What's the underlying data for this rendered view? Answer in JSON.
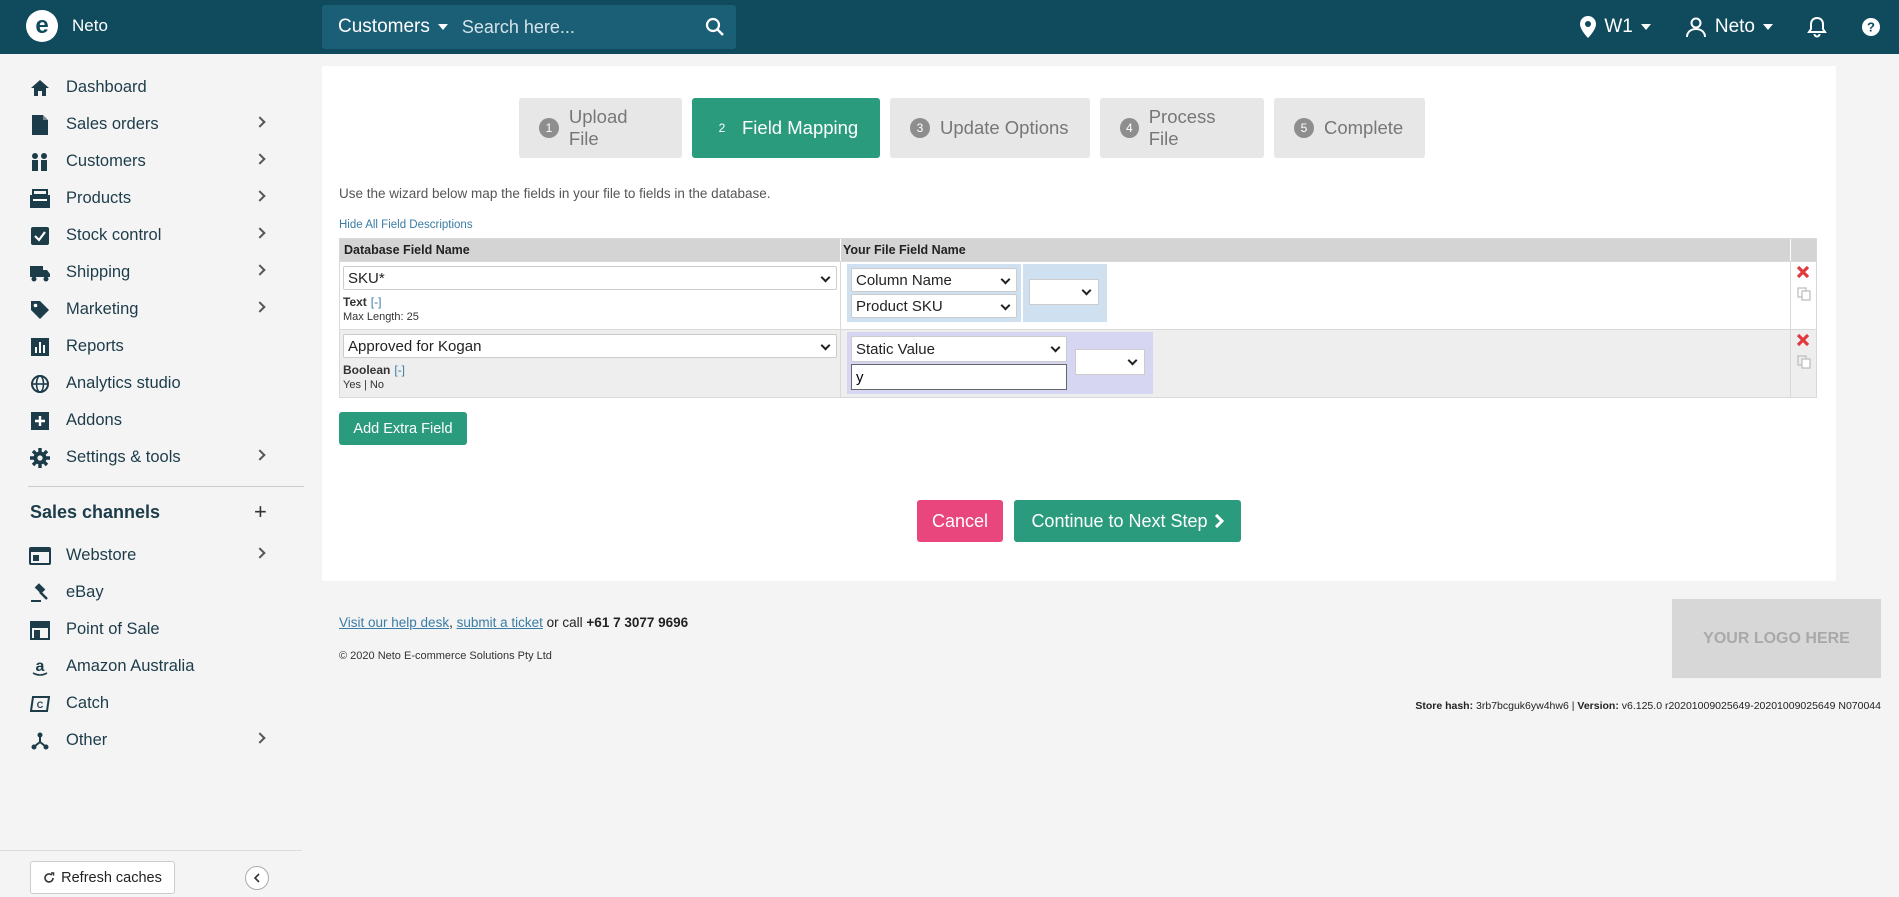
{
  "app": {
    "brand_name": "Neto",
    "brand_letter": "e"
  },
  "search": {
    "scope": "Customers",
    "placeholder": "Search here..."
  },
  "topbar": {
    "location": "W1",
    "user": "Neto"
  },
  "sidebar": {
    "items": [
      {
        "label": "Dashboard",
        "icon": "home-icon"
      },
      {
        "label": "Sales orders",
        "icon": "document-icon"
      },
      {
        "label": "Customers",
        "icon": "people-icon"
      },
      {
        "label": "Products",
        "icon": "box-icon"
      },
      {
        "label": "Stock control",
        "icon": "checkbox-icon"
      },
      {
        "label": "Shipping",
        "icon": "truck-icon"
      },
      {
        "label": "Marketing",
        "icon": "tag-icon"
      },
      {
        "label": "Reports",
        "icon": "chart-icon"
      },
      {
        "label": "Analytics studio",
        "icon": "globe-icon"
      },
      {
        "label": "Addons",
        "icon": "plus-square-icon"
      },
      {
        "label": "Settings & tools",
        "icon": "gear-icon"
      }
    ],
    "section_title": "Sales channels",
    "channels": [
      {
        "label": "Webstore",
        "icon": "browser-icon"
      },
      {
        "label": "eBay",
        "icon": "gavel-icon"
      },
      {
        "label": "Point of Sale",
        "icon": "store-icon"
      },
      {
        "label": "Amazon Australia",
        "icon": "amazon-icon"
      },
      {
        "label": "Catch",
        "icon": "catch-icon"
      },
      {
        "label": "Other",
        "icon": "nodes-icon"
      }
    ],
    "refresh_label": "Refresh caches"
  },
  "wizard": {
    "steps": [
      {
        "num": "1",
        "label": "Upload File"
      },
      {
        "num": "2",
        "label": "Field Mapping"
      },
      {
        "num": "3",
        "label": "Update Options"
      },
      {
        "num": "4",
        "label": "Process File"
      },
      {
        "num": "5",
        "label": "Complete"
      }
    ],
    "active_step": 2,
    "intro": "Use the wizard below map the fields in your file to fields in the database.",
    "hide_link": "Hide All Field Descriptions"
  },
  "mapping_table": {
    "headers": [
      "Database Field Name",
      "Your File Field Name"
    ],
    "rows": [
      {
        "db_field": "SKU*",
        "type": "Text",
        "toggle": "[-]",
        "desc": "Max Length: 25",
        "source_type": "Column Name",
        "source_value": "Product SKU"
      },
      {
        "db_field": "Approved for Kogan",
        "type": "Boolean",
        "toggle": "[-]",
        "desc": "Yes | No",
        "source_type": "Static Value",
        "source_value": "y"
      }
    ]
  },
  "buttons": {
    "add_extra": "Add Extra Field",
    "cancel": "Cancel",
    "continue": "Continue to Next Step"
  },
  "footer": {
    "help_desk": "Visit our help desk",
    "ticket": "submit a ticket",
    "or_call": "or call",
    "phone": "+61 7 3077 9696",
    "copyright": "© 2020 Neto E-commerce Solutions Pty Ltd",
    "logo_placeholder": "YOUR LOGO HERE",
    "store_hash_label": "Store hash:",
    "store_hash": "3rb7bcguk6yw4hw6",
    "version_label": "Version:",
    "version": "v6.125.0 r20201009025649-20201009025649 N070044"
  },
  "colors": {
    "topbar": "#0f4a5d",
    "accent": "#2b9b7e",
    "cancel": "#e8467c",
    "link": "#3a7ca5"
  }
}
